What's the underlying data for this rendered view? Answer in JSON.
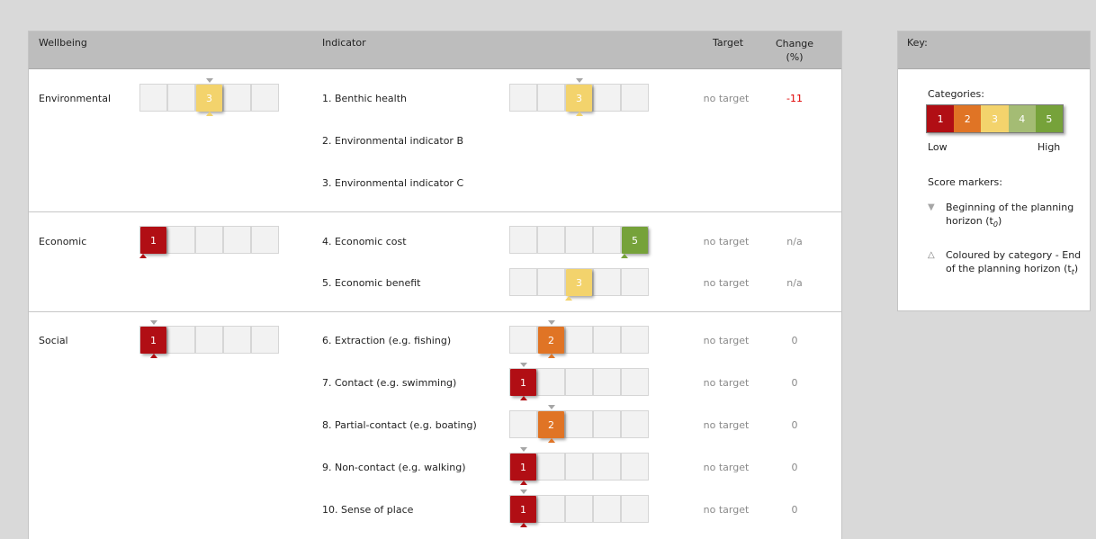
{
  "header": {
    "wellbeing": "Wellbeing",
    "indicator": "Indicator",
    "target": "Target",
    "change_line1": "Change",
    "change_line2": "(%)"
  },
  "colors": {
    "c1": "#b10e14",
    "c2": "#e07425",
    "c3": "#f3d36c",
    "c4": "#a4bc74",
    "c5": "#76a23a"
  },
  "groups": [
    {
      "label": "Environmental",
      "score": 3,
      "start": 3
    },
    {
      "label": "Economic",
      "score": 1,
      "start": null
    },
    {
      "label": "Social",
      "score": 1,
      "start": 1
    }
  ],
  "indicators": [
    {
      "label": "1. Benthic health",
      "score": 3,
      "start": 3,
      "target": "no target",
      "change": "-11",
      "negative": true
    },
    {
      "label": "2. Environmental indicator B",
      "score": null,
      "start": null,
      "target": "",
      "change": ""
    },
    {
      "label": "3. Environmental indicator C",
      "score": null,
      "start": null,
      "target": "",
      "change": ""
    },
    {
      "label": "4. Economic cost",
      "score": 5,
      "start": null,
      "target": "no target",
      "change": "n/a"
    },
    {
      "label": "5. Economic benefit",
      "score": 3,
      "start": null,
      "target": "no target",
      "change": "n/a"
    },
    {
      "label": "6. Extraction (e.g. fishing)",
      "score": 2,
      "start": 2,
      "target": "no target",
      "change": "0"
    },
    {
      "label": "7. Contact (e.g. swimming)",
      "score": 1,
      "start": 1,
      "target": "no target",
      "change": "0"
    },
    {
      "label": "8. Partial-contact (e.g. boating)",
      "score": 2,
      "start": 2,
      "target": "no target",
      "change": "0"
    },
    {
      "label": "9. Non-contact (e.g. walking)",
      "score": 1,
      "start": 1,
      "target": "no target",
      "change": "0"
    },
    {
      "label": "10. Sense of place",
      "score": 1,
      "start": 1,
      "target": "no target",
      "change": "0"
    }
  ],
  "key": {
    "title": "Key:",
    "categories_label": "Categories:",
    "categories": [
      "1",
      "2",
      "3",
      "4",
      "5"
    ],
    "low": "Low",
    "high": "High",
    "markers_label": "Score markers:",
    "begin_symbol": "▼",
    "begin_text": "Beginning of the planning horizon (t",
    "begin_sub": "0",
    "begin_close": ")",
    "end_symbol": "△",
    "end_text": "Coloured by category - End of the planning horizon (t",
    "end_sub": "t",
    "end_close": ")"
  }
}
